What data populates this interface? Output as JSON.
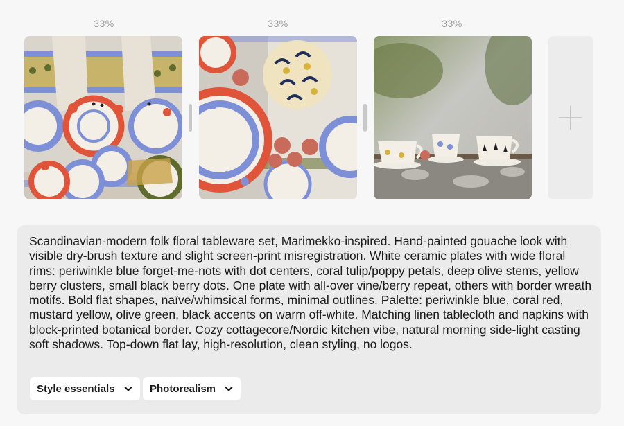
{
  "variations": [
    {
      "percent": "33%",
      "image": "scandinavian-floral-plates-wall-display"
    },
    {
      "percent": "33%",
      "image": "floral-plates-flat-lay-with-peaches"
    },
    {
      "percent": "33%",
      "image": "teacups-on-table-morning-light"
    }
  ],
  "add_tile": {
    "icon": "plus-icon"
  },
  "prompt": {
    "text": "Scandinavian-modern folk floral tableware set, Marimekko-inspired. Hand-painted gouache look with visible dry-brush texture and slight screen-print misregistration. White ceramic plates with wide floral rims: periwinkle blue forget-me-nots with dot centers, coral tulip/poppy petals, deep olive stems, yellow berry clusters, small black berry dots. One plate with all-over vine/berry repeat, others with border wreath motifs. Bold flat shapes, naïve/whimsical forms, minimal outlines. Palette: periwinkle blue, coral red, mustard yellow, olive green, black accents on warm off-white. Matching linen tablecloth and napkins with block-printed botanical border. Cozy cottagecore/Nordic kitchen vibe, natural morning side-light casting soft shadows. Top-down flat lay, high-resolution, clean styling, no logos."
  },
  "controls": {
    "style_dropdown": {
      "label": "Style essentials",
      "icon": "chevron-down-icon"
    },
    "mode_dropdown": {
      "label": "Photorealism",
      "icon": "chevron-down-icon"
    }
  },
  "colors": {
    "periwinkle": "#7d8fd6",
    "coral": "#e0553a",
    "mustard": "#d8b33a",
    "olive": "#5f6b2c",
    "offwhite": "#f3efe6"
  }
}
